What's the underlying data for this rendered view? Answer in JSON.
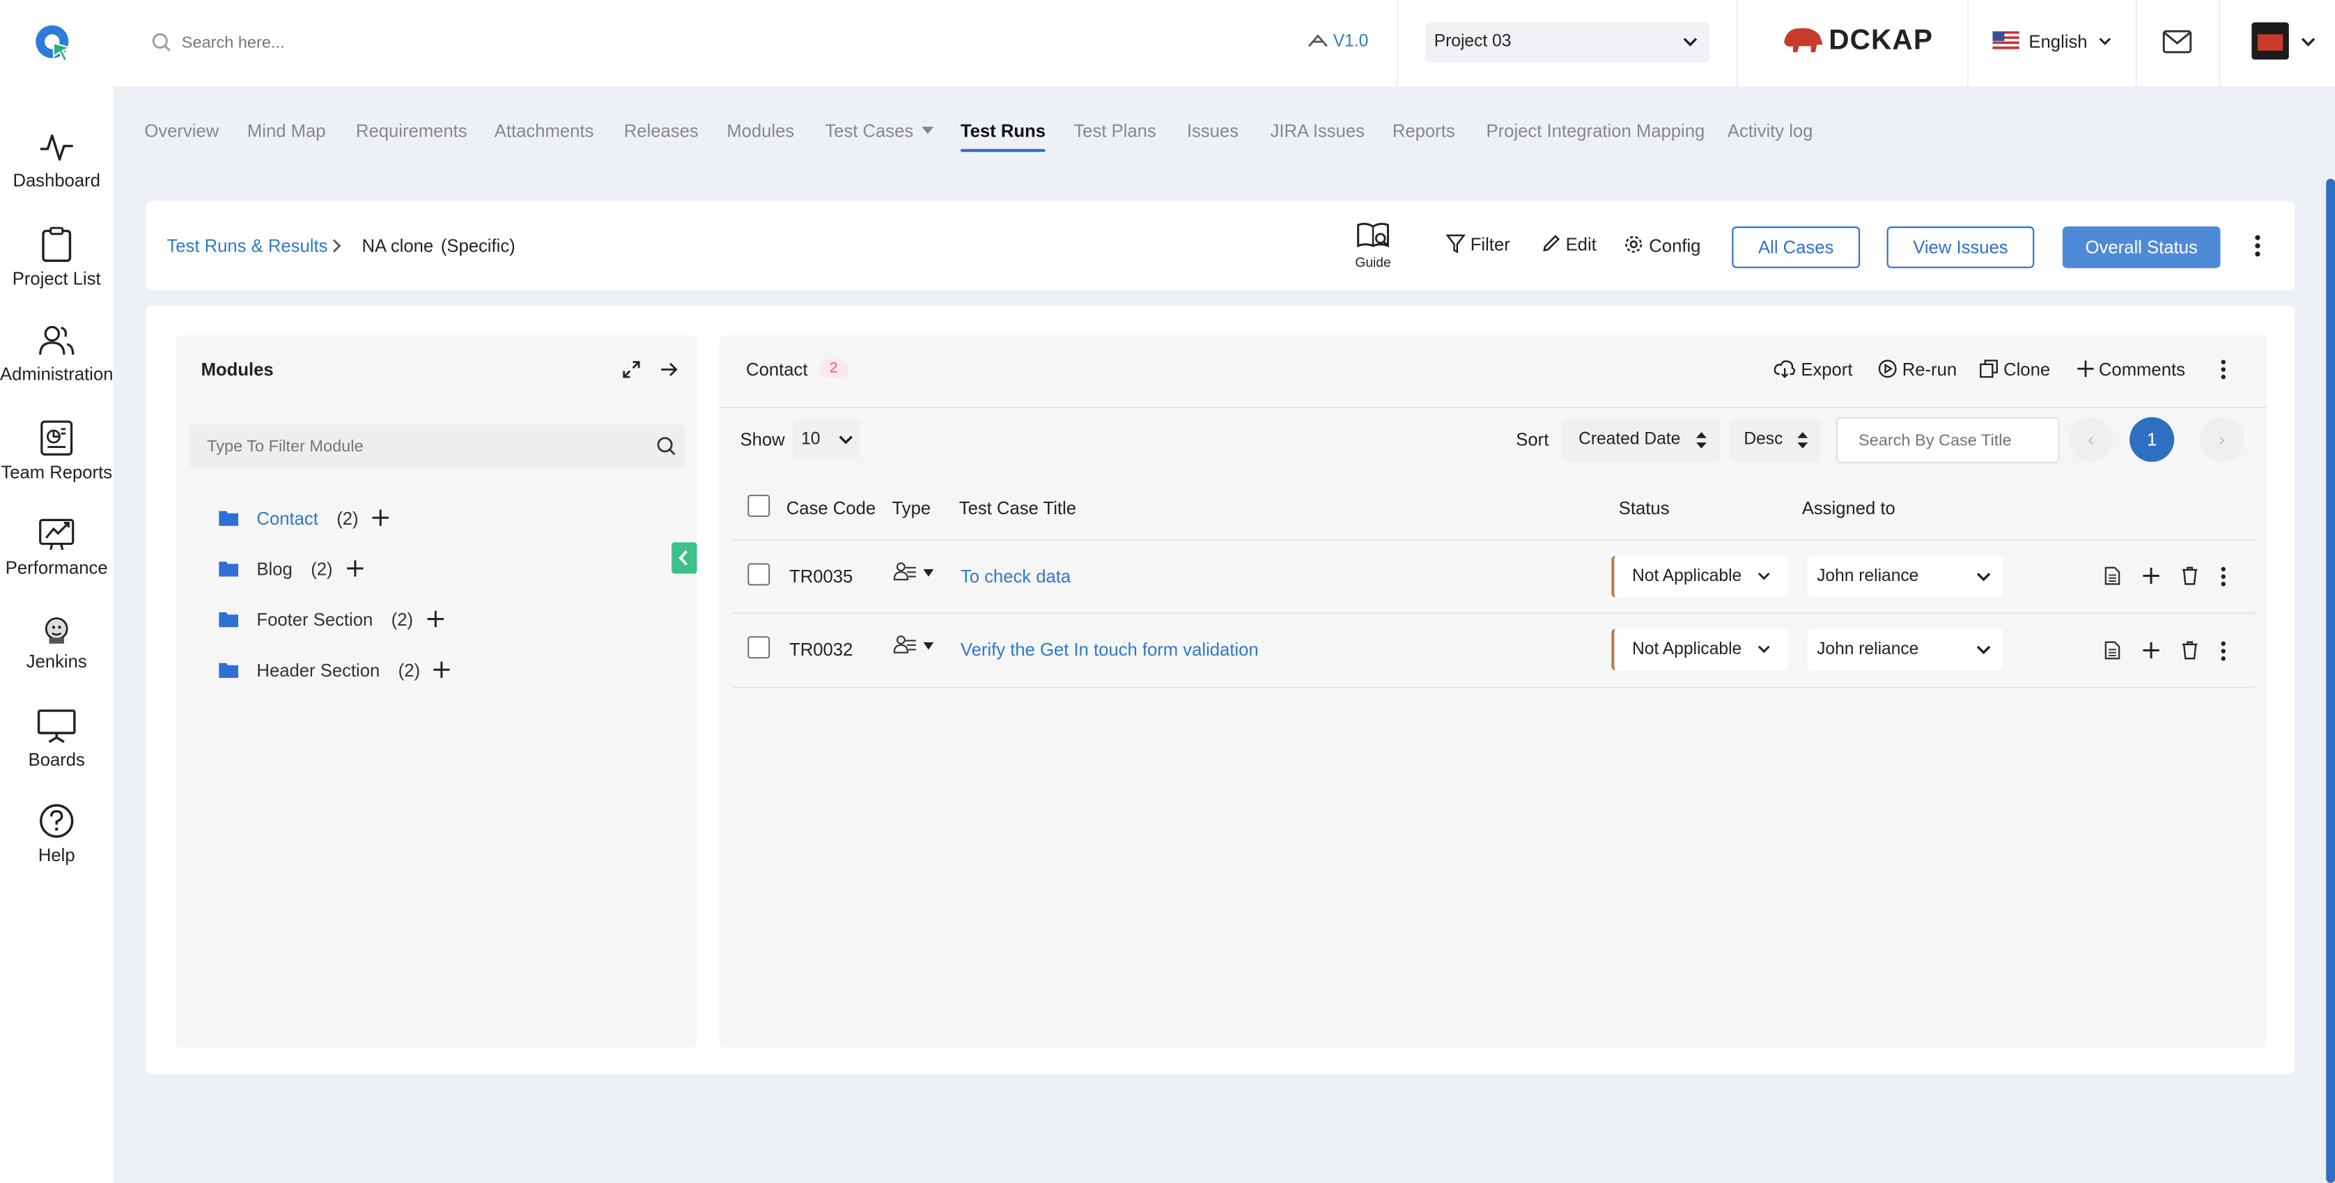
{
  "app": {
    "logo_icon": "app-logo-icon",
    "search_placeholder": "Search here...",
    "version": "V1.0",
    "project_select": "Project 03",
    "brand_logo_text": "DCKAP",
    "language": "English",
    "accent_color": "#2f6fd6"
  },
  "sidebar": {
    "items": [
      {
        "label": "Dashboard",
        "icon": "activity-icon"
      },
      {
        "label": "Project List",
        "icon": "clipboard-icon"
      },
      {
        "label": "Administration",
        "icon": "users-icon"
      },
      {
        "label": "Team Reports",
        "icon": "report-icon"
      },
      {
        "label": "Performance",
        "icon": "performance-icon"
      },
      {
        "label": "Jenkins",
        "icon": "jenkins-icon"
      },
      {
        "label": "Boards",
        "icon": "board-icon"
      },
      {
        "label": "Help",
        "icon": "help-icon"
      }
    ]
  },
  "tabs": [
    "Overview",
    "Mind Map",
    "Requirements",
    "Attachments",
    "Releases",
    "Modules",
    "Test Cases",
    "Test Runs",
    "Test Plans",
    "Issues",
    "JIRA Issues",
    "Reports",
    "Project Integration Mapping",
    "Activity log"
  ],
  "header": {
    "breadcrumb_link": "Test Runs & Results",
    "run_name": "NA clone",
    "run_type": "(Specific)",
    "guide": "Guide",
    "filter": "Filter",
    "edit": "Edit",
    "config": "Config",
    "all_cases": "All Cases",
    "view_issues": "View Issues",
    "overall_status": "Overall Status"
  },
  "modules": {
    "title": "Modules",
    "filter_placeholder": "Type To Filter Module",
    "items": [
      {
        "name": "Contact",
        "count": "(2)"
      },
      {
        "name": "Blog",
        "count": "(2)"
      },
      {
        "name": "Footer Section",
        "count": "(2)"
      },
      {
        "name": "Header Section",
        "count": "(2)"
      }
    ]
  },
  "cases": {
    "module_name": "Contact",
    "module_count": "2",
    "export": "Export",
    "rerun": "Re-run",
    "clone": "Clone",
    "comments": "Comments",
    "show_label": "Show",
    "show_value": "10",
    "sort_label": "Sort",
    "sort_field": "Created Date",
    "sort_order": "Desc",
    "search_placeholder": "Search By Case Title",
    "page": "1",
    "columns": {
      "code": "Case Code",
      "type": "Type",
      "title": "Test Case Title",
      "status": "Status",
      "assigned": "Assigned to"
    },
    "rows": [
      {
        "code": "TR0035",
        "title": "To check data",
        "status": "Not Applicable",
        "assignee": "John reliance"
      },
      {
        "code": "TR0032",
        "title": "Verify the Get In touch form validation",
        "status": "Not Applicable",
        "assignee": "John reliance"
      }
    ]
  }
}
